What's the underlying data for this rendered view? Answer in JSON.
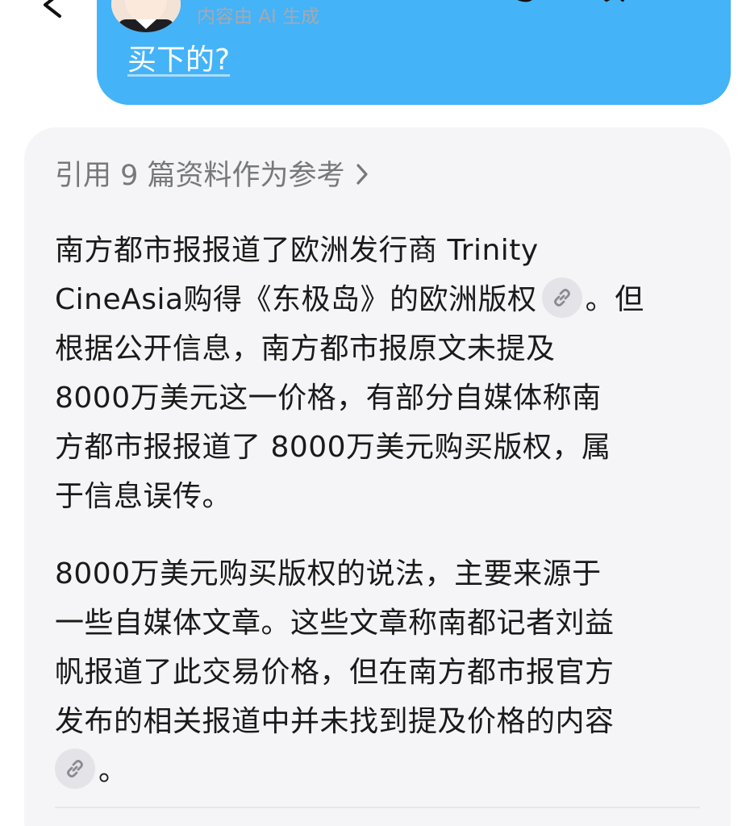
{
  "header": {
    "ai_note": "内容由 AI 生成",
    "back_icon": "chevron-left-icon",
    "icons": [
      "paperclip-icon",
      "mute-icon",
      "more-icon"
    ]
  },
  "user_message": {
    "text": "买下的?"
  },
  "answer": {
    "references_label": "引用 9 篇资料作为参考",
    "paragraph1": {
      "line1": "南方都市报报道了欧洲发行商 Trinity",
      "line2a": "CineAsia购得《东极岛》的欧洲版权",
      "line2b": "。但",
      "line3": "根据公开信息，南方都市报原文未提及",
      "line4": " 8000万美元这一价格，有部分自媒体称南",
      "line5": "方都市报报道了 8000万美元购买版权，属",
      "line6": "于信息误传。"
    },
    "paragraph2": {
      "line1": "8000万美元购买版权的说法，主要来源于",
      "line2": "一些自媒体文章。这些文章称南都记者刘益",
      "line3": "帆报道了此交易价格，但在南方都市报官方",
      "line4": "发布的相关报道中并未找到提及价格的内容",
      "line5": "。"
    }
  },
  "colors": {
    "bubble": "#44b3f8",
    "card": "#f5f5f7",
    "text": "#1a1a1a",
    "muted": "#77787c"
  }
}
